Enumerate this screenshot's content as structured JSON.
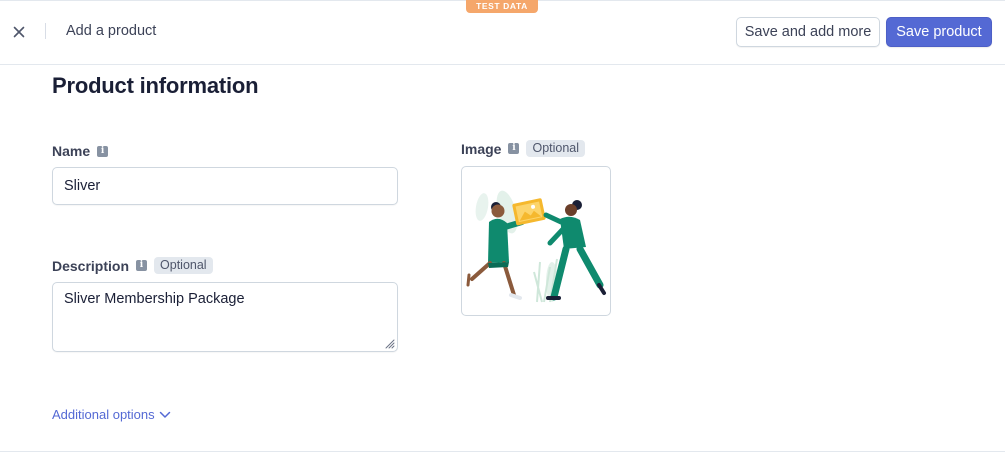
{
  "header": {
    "test_badge": "TEST DATA",
    "close_icon": "close-icon",
    "title": "Add a product",
    "save_more_label": "Save and add more",
    "save_label": "Save product"
  },
  "section": {
    "title": "Product information"
  },
  "fields": {
    "name": {
      "label": "Name",
      "value": "Sliver"
    },
    "description": {
      "label": "Description",
      "optional": "Optional",
      "value": "Sliver Membership Package"
    },
    "image": {
      "label": "Image",
      "optional": "Optional"
    }
  },
  "additional_options": "Additional options",
  "colors": {
    "primary": "#5469d4",
    "badge": "#f5a76b",
    "illustration_green": "#0f8a6e",
    "illustration_yellow": "#f5b82e"
  }
}
